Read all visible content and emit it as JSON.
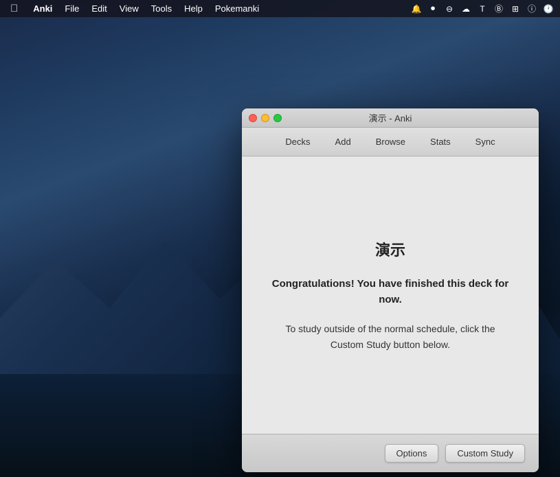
{
  "desktop": {
    "background": "macOS Big Sur mountain landscape"
  },
  "menubar": {
    "apple": "🍎",
    "items": [
      "Anki",
      "File",
      "Edit",
      "View",
      "Tools",
      "Help",
      "Pokemanki"
    ],
    "anki_bold": "Anki"
  },
  "window": {
    "title": "演示 - Anki",
    "toolbar": {
      "buttons": [
        "Decks",
        "Add",
        "Browse",
        "Stats",
        "Sync"
      ]
    },
    "content": {
      "deck_title": "演示",
      "congrats": "Congratulations! You have finished this deck for now.",
      "hint": "To study outside of the normal schedule, click the Custom Study button below."
    },
    "footer": {
      "options_label": "Options",
      "custom_study_label": "Custom Study"
    }
  }
}
